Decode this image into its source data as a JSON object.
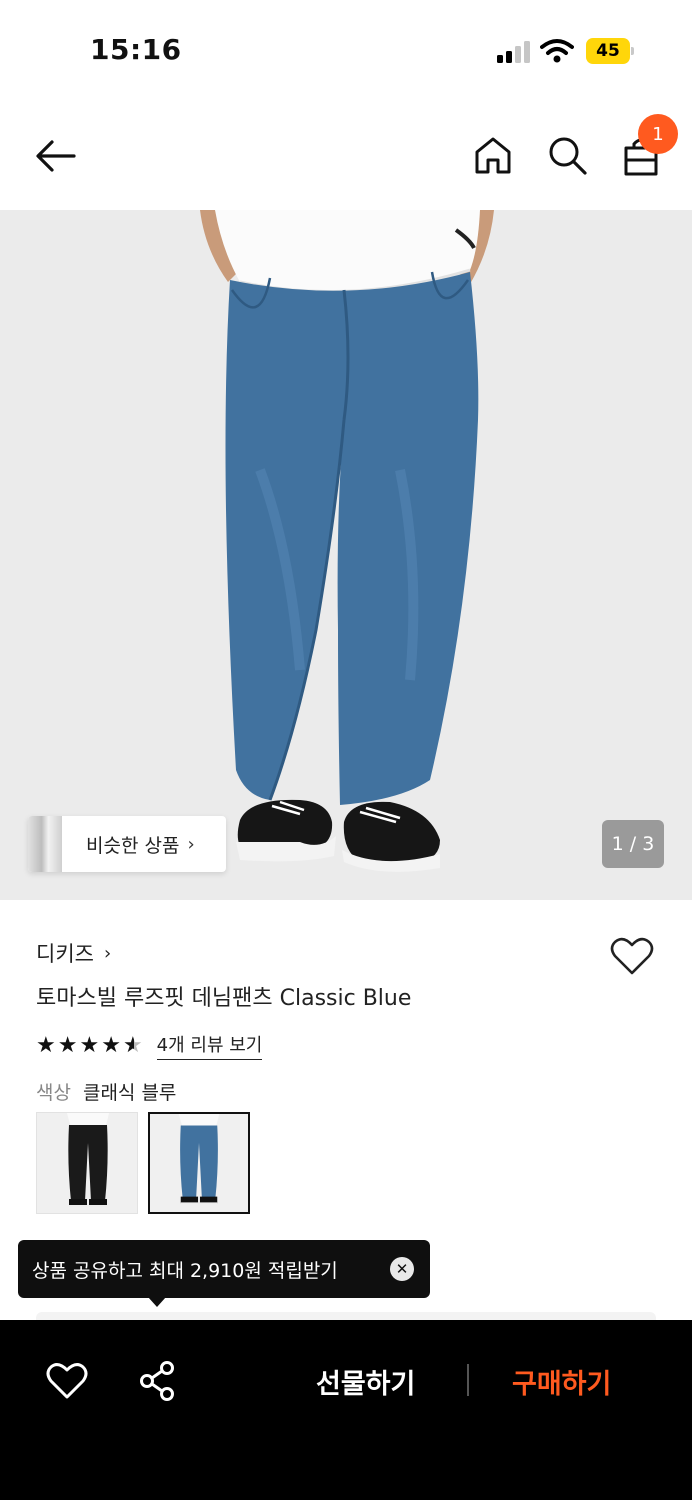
{
  "status_bar": {
    "time": "15:16",
    "battery": "45",
    "battery_color": "#ffd60a"
  },
  "nav": {
    "back_icon": "arrow-left-icon",
    "home_icon": "home-icon",
    "search_icon": "search-icon",
    "bag_icon": "shopping-bag-icon",
    "cart_count": "1",
    "badge_color": "#ff5a1f"
  },
  "gallery": {
    "similar_label": "비슷한 상품",
    "similar_chevron": "›",
    "page_indicator": "1 / 3"
  },
  "product": {
    "brand": "디키즈",
    "brand_chevron": "›",
    "title": "토마스빌 루즈핏 데님팬츠 Classic Blue",
    "rating": 4.5,
    "stars": [
      "★",
      "★",
      "★",
      "★",
      "★"
    ],
    "review_link": "4개 리뷰 보기",
    "color_key": "색상",
    "color_value": "클래식 블루",
    "color_options": [
      {
        "name": "black",
        "selected": false
      },
      {
        "name": "classic-blue",
        "selected": true
      }
    ]
  },
  "tooltip": {
    "text": "상품 공유하고 최대 2,910원 적립받기",
    "close_glyph": "✕"
  },
  "bottom_bar": {
    "heart_icon": "heart-icon",
    "share_icon": "share-icon",
    "gift_label": "선물하기",
    "buy_label": "구매하기",
    "buy_color": "#ff5a1f"
  }
}
